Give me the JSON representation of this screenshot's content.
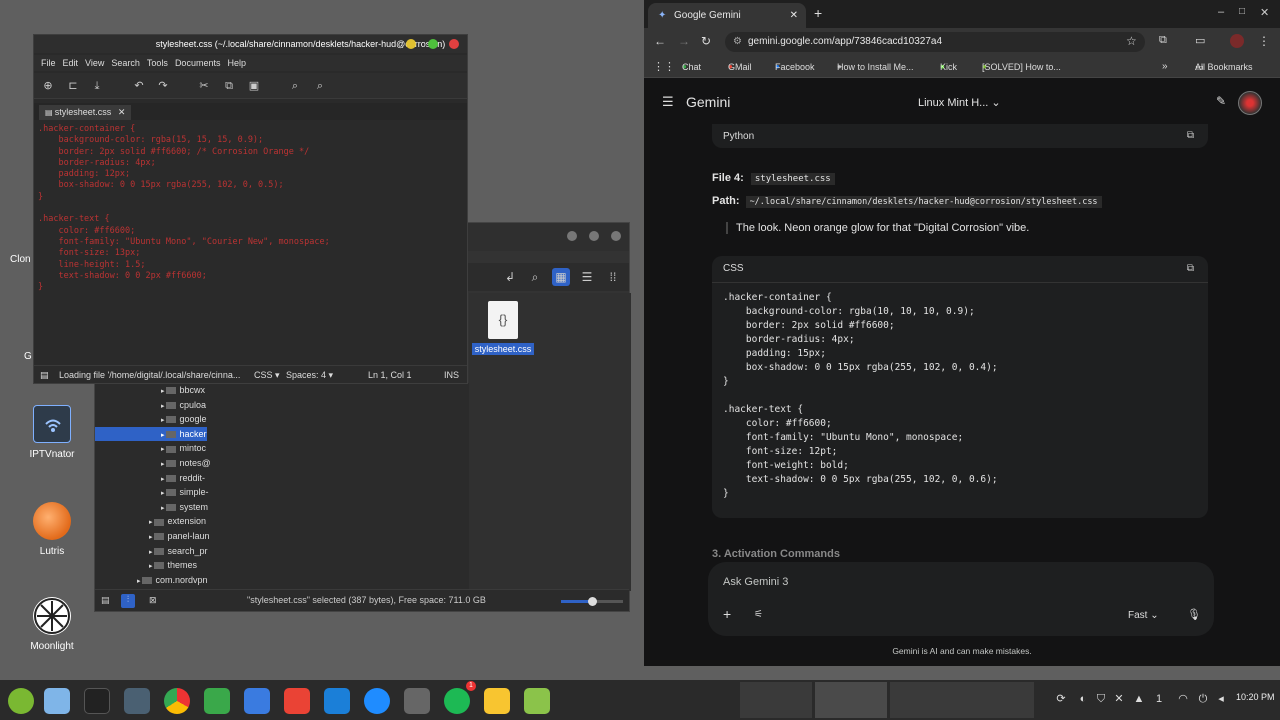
{
  "desktop": {
    "icons": [
      {
        "label": "IPTVnator",
        "icon": "wifi-tv-icon"
      },
      {
        "label": "Lutris",
        "icon": "lutris-icon"
      },
      {
        "label": "Moonlight",
        "icon": "moonlight-icon"
      }
    ],
    "partial_labels": [
      "Clon",
      "G"
    ]
  },
  "editor": {
    "title": "stylesheet.css (~/.local/share/cinnamon/desklets/hacker-hud@corrosion)",
    "menu": [
      "File",
      "Edit",
      "View",
      "Search",
      "Tools",
      "Documents",
      "Help"
    ],
    "tab": "stylesheet.css",
    "code_lines": [
      ".hacker-container {",
      "    background-color: rgba(15, 15, 15, 0.9);",
      "    border: 2px solid #ff6600; /* Corrosion Orange */",
      "    border-radius: 4px;",
      "    padding: 12px;",
      "    box-shadow: 0 0 15px rgba(255, 102, 0, 0.5);",
      "}",
      "",
      ".hacker-text {",
      "    color: #ff6600;",
      "    font-family: \"Ubuntu Mono\", \"Courier New\", monospace;",
      "    font-size: 13px;",
      "    line-height: 1.5;",
      "    text-shadow: 0 0 2px #ff6600;",
      "}"
    ],
    "status": {
      "loading": "Loading file '/home/digital/.local/share/cinna...",
      "language": "CSS",
      "spaces": "Spaces: 4",
      "position": "Ln 1, Col 1",
      "mode": "INS"
    }
  },
  "file_manager": {
    "file_label": "stylesheet.css",
    "tree": [
      {
        "label": "bbcwx",
        "level": 3
      },
      {
        "label": "cpuloa",
        "level": 3
      },
      {
        "label": "google",
        "level": 3
      },
      {
        "label": "hacker",
        "level": 3,
        "selected": true
      },
      {
        "label": "mintoc",
        "level": 3
      },
      {
        "label": "notes@",
        "level": 3
      },
      {
        "label": "reddit-",
        "level": 3
      },
      {
        "label": "simple-",
        "level": 3
      },
      {
        "label": "system",
        "level": 3
      },
      {
        "label": "extension",
        "level": 2
      },
      {
        "label": "panel-laun",
        "level": 2
      },
      {
        "label": "search_pr",
        "level": 2
      },
      {
        "label": "themes",
        "level": 2
      },
      {
        "label": "com.nordvpn",
        "level": 1
      }
    ],
    "status": "\"stylesheet.css\" selected (387 bytes), Free space: 711.0 GB"
  },
  "browser": {
    "tab_title": "Google Gemini",
    "url": "gemini.google.com/app/73846cacd10327a4",
    "bookmarks": [
      "Chat",
      "GMail",
      "Facebook",
      "How to Install Me...",
      "Kick",
      "[SOLVED] How to..."
    ],
    "all_bookmarks": "All Bookmarks",
    "app_name": "Gemini",
    "chat_title": "Linux Mint H...",
    "python_label": "Python",
    "file_heading": "File 4:",
    "file_name_code": "stylesheet.css",
    "path_label": "Path:",
    "path_code": "~/.local/share/cinnamon/desklets/hacker-hud@corrosion/stylesheet.css",
    "quote": "The look. Neon orange glow for that \"Digital Corrosion\" vibe.",
    "css_label": "CSS",
    "css_lines": [
      ".hacker-container {",
      "    background-color: rgba(10, 10, 10, 0.9);",
      "    border: 2px solid #ff6600;",
      "    border-radius: 4px;",
      "    padding: 15px;",
      "    box-shadow: 0 0 15px rgba(255, 102, 0, 0.4);",
      "}",
      "",
      ".hacker-text {",
      "    color: #ff6600;",
      "    font-family: \"Ubuntu Mono\", monospace;",
      "    font-size: 12pt;",
      "    font-weight: bold;",
      "    text-shadow: 0 0 5px rgba(255, 102, 0, 0.6);",
      "}"
    ],
    "section_heading": "3. Activation Commands",
    "input_placeholder": "Ask Gemini 3",
    "model": "Fast",
    "disclaimer": "Gemini is AI and can make mistakes."
  },
  "taskbar": {
    "time": "10:20 PM",
    "tray_badge": "1",
    "notif_badge": "1"
  },
  "colors": {
    "accent_orange": "#ff6600",
    "selection_blue": "#2f62c6",
    "mac_yellow": "#e0c030",
    "mac_green": "#4ec03c",
    "mac_red": "#e04040"
  }
}
